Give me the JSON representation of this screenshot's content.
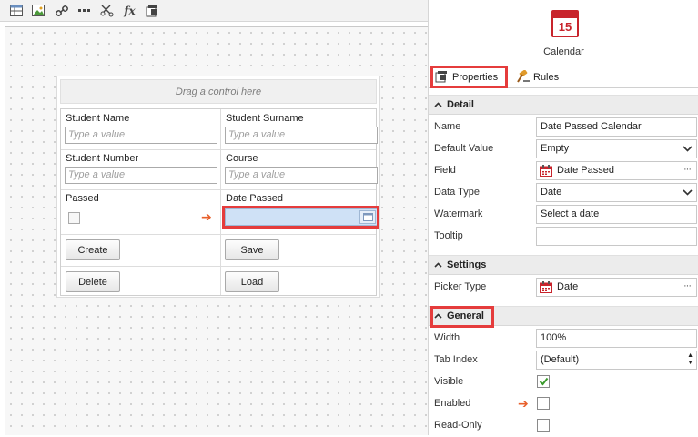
{
  "toolbar": {
    "buttons": [
      "table-icon",
      "image-icon",
      "link-icon",
      "more-icon",
      "cut-icon",
      "fx-icon",
      "properties-icon"
    ],
    "fx_label": "fx"
  },
  "form": {
    "drag_hint": "Drag a control here",
    "fields": {
      "student_name_label": "Student Name",
      "student_name_placeholder": "Type a value",
      "student_surname_label": "Student Surname",
      "student_surname_placeholder": "Type a value",
      "student_number_label": "Student Number",
      "student_number_placeholder": "Type a value",
      "course_label": "Course",
      "course_placeholder": "Type a value",
      "passed_label": "Passed",
      "date_passed_label": "Date Passed"
    },
    "buttons": {
      "create": "Create",
      "save": "Save",
      "delete": "Delete",
      "load": "Load"
    }
  },
  "panel": {
    "control_icon_day": "15",
    "control_name": "Calendar",
    "tabs": [
      {
        "label": "Properties",
        "active": true
      },
      {
        "label": "Rules",
        "active": false
      }
    ],
    "sections": {
      "detail": "Detail",
      "settings": "Settings",
      "general": "General"
    },
    "detail": {
      "name_label": "Name",
      "name_value": "Date Passed Calendar",
      "default_value_label": "Default Value",
      "default_value_value": "Empty",
      "field_label": "Field",
      "field_value": "Date Passed",
      "data_type_label": "Data Type",
      "data_type_value": "Date",
      "watermark_label": "Watermark",
      "watermark_value": "Select a date",
      "tooltip_label": "Tooltip",
      "tooltip_value": ""
    },
    "settings": {
      "picker_type_label": "Picker Type",
      "picker_type_value": "Date"
    },
    "general": {
      "width_label": "Width",
      "width_value": "100%",
      "tab_index_label": "Tab Index",
      "tab_index_value": "(Default)",
      "visible_label": "Visible",
      "visible_checked": true,
      "enabled_label": "Enabled",
      "enabled_checked": false,
      "readonly_label": "Read-Only",
      "readonly_checked": false
    },
    "ellipsis": "···"
  },
  "colors": {
    "highlight": "#e53c3c",
    "arrow": "#e8602c",
    "calendar_red": "#c8242c",
    "calendar_input": "#cfe1f6",
    "check_green": "#3a9a2c"
  }
}
